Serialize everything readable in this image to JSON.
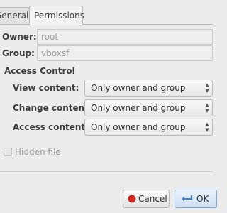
{
  "tabs": [
    {
      "label": "General",
      "active": false
    },
    {
      "label": "Permissions",
      "active": true
    }
  ],
  "owner": {
    "label": "Owner:",
    "value": "root"
  },
  "group": {
    "label": "Group:",
    "value": "vboxsf"
  },
  "access_control": {
    "title": "Access Control",
    "rows": [
      {
        "label": "View content:",
        "value": "Only owner and group"
      },
      {
        "label": "Change content:",
        "value": "Only owner and group"
      },
      {
        "label": "Access content:",
        "value": "Only owner and group"
      }
    ]
  },
  "hidden_file": {
    "label": "Hidden file",
    "checked": false,
    "enabled": false
  },
  "buttons": {
    "cancel": "Cancel",
    "ok": "OK"
  },
  "colors": {
    "cancel_icon": "#d9261c",
    "ok_icon": "#3e7fc1"
  }
}
